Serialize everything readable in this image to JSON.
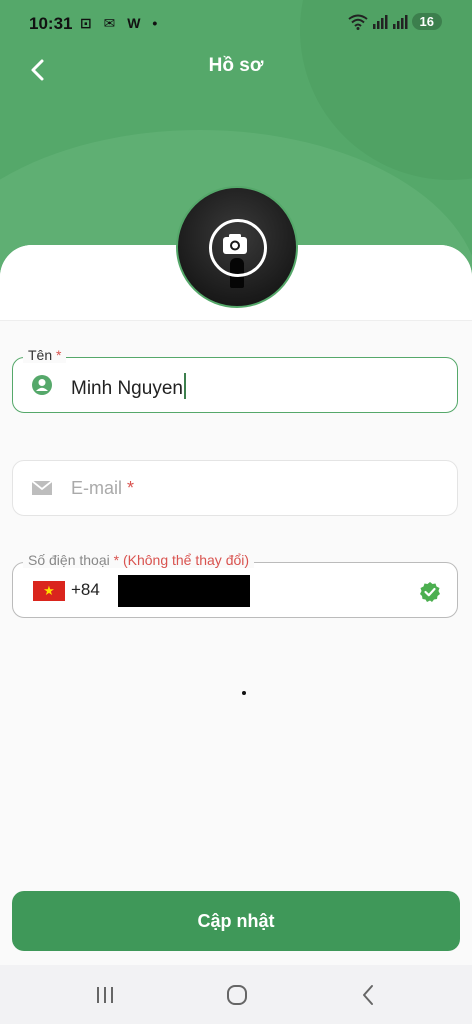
{
  "status": {
    "time": "10:31",
    "left_icons": "⊡ ✉ W •",
    "battery": "16"
  },
  "header": {
    "title": "Hồ sơ"
  },
  "form": {
    "name": {
      "label": "Tên",
      "required": "*",
      "value": "Minh Nguyen"
    },
    "email": {
      "placeholder": "E-mail",
      "required": "*"
    },
    "phone": {
      "label": "Số điện thoại",
      "required": "* (Không thể thay đổi)",
      "dial_code": "+84"
    }
  },
  "actions": {
    "update_label": "Cập nhật"
  },
  "colors": {
    "primary": "#55a86a",
    "button": "#3f9859",
    "required": "#d9534f"
  },
  "icons": [
    "back-icon",
    "camera-icon",
    "person-icon",
    "mail-icon",
    "vn-flag-icon",
    "verified-icon",
    "recents-icon",
    "home-icon",
    "nav-back-icon"
  ]
}
